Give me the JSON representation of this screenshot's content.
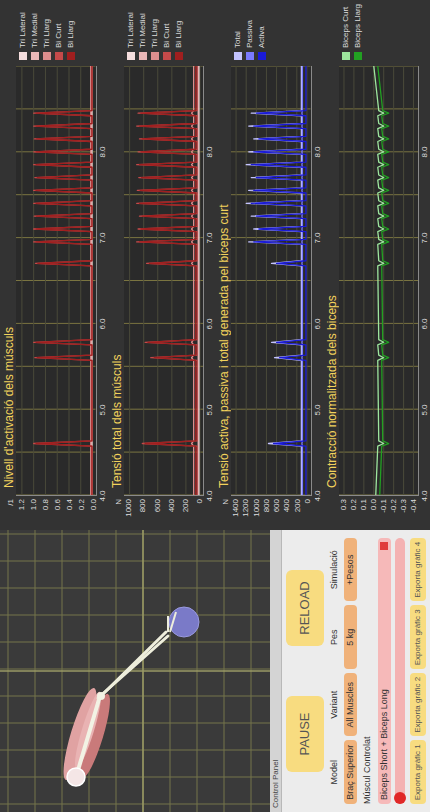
{
  "control_panel": {
    "title": "Control Panel",
    "buttons": [
      "PAUSE",
      "RELOAD"
    ],
    "fields": [
      {
        "label": "Model",
        "value": "Braç Superior"
      },
      {
        "label": "Variant",
        "value": "All Muscles"
      },
      {
        "label": "Pes",
        "value": "5 kg"
      },
      {
        "label": "Simulació",
        "value": "+Pesos"
      }
    ],
    "controlled_muscle": {
      "label": "Múscul Controlat",
      "value": "Biceps Short + Biceps Long"
    },
    "slider": {
      "level": 0.0
    },
    "export_buttons": [
      "Exporta gràfic 1",
      "Exporta gràfic 2",
      "Exporta gràfic 3",
      "Exporta gràfic 4"
    ]
  },
  "time_axis": {
    "ticks": [
      "4.0",
      "5.0",
      "6.0",
      "7.0",
      "8.0"
    ],
    "t": [
      4.0,
      4.57,
      4.6,
      4.63,
      5.57,
      5.6,
      5.63,
      5.75,
      5.78,
      5.81,
      6.67,
      6.7,
      6.73,
      6.92,
      6.95,
      6.98,
      7.07,
      7.1,
      7.13,
      7.22,
      7.25,
      7.28,
      7.37,
      7.4,
      7.43,
      7.52,
      7.55,
      7.58,
      7.67,
      7.7,
      7.73,
      7.82,
      7.85,
      7.88,
      7.97,
      8.0,
      8.03,
      8.12,
      8.15,
      8.18,
      8.27,
      8.3,
      8.33,
      8.42,
      8.45,
      8.48,
      9.0
    ]
  },
  "charts": [
    {
      "title": "Nivell d'activació dels músculs",
      "unit": "/1",
      "y_min": -0.05,
      "y_max": 1.3,
      "y_ticks": [
        "0.0",
        "0.2",
        "0.4",
        "0.6",
        "0.8",
        "1.0",
        "1.2"
      ],
      "series": [
        {
          "name": "Tri Lateral",
          "color": "#f5dede",
          "values": [
            0.01,
            0.01,
            0.01,
            0.01,
            0.01,
            0.01,
            0.01,
            0.01,
            0.01,
            0.01,
            0.01,
            0.01,
            0.01,
            0.01,
            0.01,
            0.01,
            0.01,
            0.01,
            0.01,
            0.01,
            0.01,
            0.01,
            0.01,
            0.01,
            0.01,
            0.01,
            0.01,
            0.01,
            0.01,
            0.01,
            0.01,
            0.01,
            0.01,
            0.01,
            0.01,
            0.01,
            0.01,
            0.01,
            0.01,
            0.01,
            0.01,
            0.01,
            0.01,
            0.01,
            0.01,
            0.01,
            0.01
          ]
        },
        {
          "name": "Tri Medial",
          "color": "#ebb8b8",
          "values": [
            0.02,
            0.02,
            0.02,
            0.02,
            0.02,
            0.02,
            0.02,
            0.02,
            0.02,
            0.02,
            0.02,
            0.02,
            0.02,
            0.02,
            0.02,
            0.02,
            0.02,
            0.02,
            0.02,
            0.02,
            0.02,
            0.02,
            0.02,
            0.02,
            0.02,
            0.02,
            0.02,
            0.02,
            0.02,
            0.02,
            0.02,
            0.02,
            0.02,
            0.02,
            0.02,
            0.02,
            0.02,
            0.02,
            0.02,
            0.02,
            0.02,
            0.02,
            0.02,
            0.02,
            0.02,
            0.02,
            0.02
          ]
        },
        {
          "name": "Tri Llarg",
          "color": "#dd8e8e",
          "values": [
            0.03,
            0.03,
            0.03,
            0.03,
            0.03,
            0.03,
            0.03,
            0.03,
            0.03,
            0.03,
            0.03,
            0.03,
            0.03,
            0.03,
            0.03,
            0.03,
            0.03,
            0.03,
            0.03,
            0.03,
            0.03,
            0.03,
            0.03,
            0.03,
            0.03,
            0.03,
            0.03,
            0.03,
            0.03,
            0.03,
            0.03,
            0.03,
            0.03,
            0.03,
            0.03,
            0.03,
            0.03,
            0.03,
            0.03,
            0.03,
            0.03,
            0.03,
            0.03,
            0.03,
            0.03,
            0.03,
            0.03
          ]
        },
        {
          "name": "Bi Curt",
          "color": "#c44a4a",
          "values": [
            0.01,
            0.01,
            1.0,
            0.01,
            0.01,
            0.98,
            0.01,
            0.01,
            1.0,
            0.01,
            0.01,
            0.97,
            0.01,
            0.01,
            1.0,
            0.01,
            0.01,
            1.0,
            0.01,
            0.01,
            0.99,
            0.01,
            0.01,
            1.0,
            0.01,
            0.01,
            1.0,
            0.01,
            0.01,
            0.98,
            0.01,
            0.01,
            1.0,
            0.01,
            0.01,
            1.0,
            0.01,
            0.01,
            0.99,
            0.01,
            0.01,
            1.0,
            0.01,
            0.01,
            1.0,
            0.01,
            0.01
          ]
        },
        {
          "name": "Bi Llarg",
          "color": "#a01f1f",
          "values": [
            0.01,
            0.01,
            0.96,
            0.01,
            0.01,
            0.94,
            0.01,
            0.01,
            0.96,
            0.01,
            0.01,
            0.93,
            0.01,
            0.01,
            0.96,
            0.01,
            0.01,
            0.96,
            0.01,
            0.01,
            0.95,
            0.01,
            0.01,
            0.96,
            0.01,
            0.01,
            0.96,
            0.01,
            0.01,
            0.94,
            0.01,
            0.01,
            0.96,
            0.01,
            0.01,
            0.96,
            0.01,
            0.01,
            0.95,
            0.01,
            0.01,
            0.96,
            0.01,
            0.01,
            0.96,
            0.01,
            0.01
          ]
        }
      ]
    },
    {
      "title": "Tensió total dels músculs",
      "unit": "N",
      "y_min": -50,
      "y_max": 1080,
      "y_ticks": [
        "0",
        "200",
        "400",
        "600",
        "800",
        "1000"
      ],
      "series": [
        {
          "name": "Tri Lateral",
          "color": "#f5dede",
          "values": [
            15,
            15,
            15,
            15,
            15,
            15,
            15,
            15,
            15,
            15,
            15,
            15,
            15,
            15,
            15,
            15,
            15,
            15,
            15,
            15,
            15,
            15,
            15,
            15,
            15,
            15,
            15,
            15,
            15,
            15,
            15,
            15,
            15,
            15,
            15,
            15,
            15,
            15,
            15,
            15,
            15,
            15,
            15,
            15,
            15,
            15,
            15
          ]
        },
        {
          "name": "Tri Medial",
          "color": "#ebb8b8",
          "values": [
            25,
            25,
            25,
            25,
            25,
            25,
            25,
            25,
            25,
            25,
            25,
            25,
            25,
            25,
            25,
            25,
            25,
            25,
            25,
            25,
            25,
            25,
            25,
            25,
            25,
            25,
            25,
            25,
            25,
            25,
            25,
            25,
            25,
            25,
            25,
            25,
            25,
            25,
            25,
            25,
            25,
            25,
            25,
            25,
            25,
            25,
            25
          ]
        },
        {
          "name": "Tri Llarg",
          "color": "#dd8e8e",
          "values": [
            90,
            90,
            120,
            90,
            90,
            120,
            90,
            90,
            120,
            90,
            90,
            120,
            90,
            90,
            120,
            90,
            90,
            120,
            90,
            90,
            120,
            90,
            90,
            120,
            90,
            90,
            120,
            90,
            90,
            120,
            90,
            90,
            120,
            90,
            90,
            120,
            90,
            90,
            120,
            90,
            90,
            120,
            90,
            90,
            120,
            90,
            90
          ]
        },
        {
          "name": "Bi Curt",
          "color": "#c44a4a",
          "values": [
            40,
            40,
            820,
            40,
            40,
            700,
            40,
            40,
            780,
            40,
            40,
            760,
            40,
            40,
            900,
            40,
            40,
            880,
            40,
            40,
            860,
            40,
            40,
            900,
            40,
            40,
            890,
            40,
            40,
            870,
            40,
            40,
            900,
            40,
            40,
            880,
            40,
            40,
            860,
            40,
            40,
            900,
            40,
            40,
            880,
            40,
            40
          ]
        },
        {
          "name": "Bi Llarg",
          "color": "#a01f1f",
          "values": [
            60,
            60,
            780,
            60,
            60,
            650,
            60,
            60,
            740,
            60,
            60,
            720,
            60,
            60,
            860,
            60,
            60,
            840,
            60,
            60,
            820,
            60,
            60,
            860,
            60,
            60,
            850,
            60,
            60,
            830,
            60,
            60,
            860,
            60,
            60,
            840,
            60,
            60,
            820,
            60,
            60,
            860,
            60,
            60,
            840,
            60,
            60
          ]
        }
      ]
    },
    {
      "title": "Tensió activa, passiva i total generada pel biceps curt",
      "unit": "N",
      "y_min": -70,
      "y_max": 1500,
      "y_ticks": [
        "0",
        "200",
        "400",
        "600",
        "800",
        "1000",
        "1200",
        "1400"
      ],
      "series": [
        {
          "name": "Total",
          "color": "#c4c4ff",
          "values": [
            110,
            110,
            760,
            110,
            110,
            640,
            110,
            110,
            700,
            110,
            110,
            700,
            110,
            110,
            1150,
            110,
            110,
            1050,
            110,
            110,
            1100,
            110,
            110,
            1200,
            110,
            110,
            1150,
            110,
            110,
            1100,
            110,
            110,
            1200,
            110,
            110,
            1150,
            110,
            110,
            1050,
            110,
            110,
            1150,
            110,
            110,
            1100,
            110,
            110
          ]
        },
        {
          "name": "Passiva",
          "color": "#7a7aff",
          "values": [
            90,
            90,
            100,
            90,
            90,
            100,
            90,
            90,
            100,
            90,
            90,
            100,
            90,
            90,
            100,
            90,
            90,
            100,
            90,
            90,
            100,
            90,
            90,
            100,
            90,
            90,
            100,
            90,
            90,
            100,
            90,
            90,
            100,
            90,
            90,
            100,
            90,
            90,
            100,
            90,
            90,
            100,
            90,
            90,
            100,
            90,
            90
          ]
        },
        {
          "name": "Activa",
          "color": "#1a1ad8",
          "values": [
            20,
            20,
            660,
            20,
            20,
            540,
            20,
            20,
            600,
            20,
            20,
            600,
            20,
            20,
            1050,
            20,
            20,
            950,
            20,
            20,
            1000,
            20,
            20,
            1100,
            20,
            20,
            1050,
            20,
            20,
            1000,
            20,
            20,
            1100,
            20,
            20,
            1050,
            20,
            20,
            950,
            20,
            20,
            1050,
            20,
            20,
            1000,
            20,
            20
          ]
        }
      ]
    },
    {
      "title": "Contracció normalitzada dels biceps",
      "y_min": -0.45,
      "y_max": 0.35,
      "y_ticks": [
        "-0.4",
        "-0.3",
        "-0.2",
        "-0.1",
        "0.0",
        "0.1",
        "0.2",
        "0.3"
      ],
      "series": [
        {
          "name": "Biceps Curt",
          "color": "#9ee69e",
          "values": [
            -0.02,
            -0.04,
            -0.1,
            -0.05,
            -0.04,
            -0.1,
            -0.05,
            -0.04,
            -0.1,
            -0.05,
            -0.04,
            -0.1,
            -0.05,
            -0.04,
            -0.1,
            -0.05,
            -0.04,
            -0.1,
            -0.05,
            -0.04,
            -0.1,
            -0.05,
            -0.04,
            -0.1,
            -0.05,
            -0.04,
            -0.1,
            -0.05,
            -0.04,
            -0.1,
            -0.05,
            -0.04,
            -0.1,
            -0.05,
            -0.04,
            -0.1,
            -0.05,
            -0.04,
            -0.1,
            -0.05,
            -0.04,
            -0.1,
            -0.05,
            -0.04,
            -0.1,
            -0.05,
            0.0
          ]
        },
        {
          "name": "Biceps Llarg",
          "color": "#22a022",
          "values": [
            -0.06,
            -0.08,
            -0.15,
            -0.09,
            -0.08,
            -0.15,
            -0.09,
            -0.08,
            -0.15,
            -0.09,
            -0.08,
            -0.15,
            -0.09,
            -0.08,
            -0.15,
            -0.09,
            -0.08,
            -0.15,
            -0.09,
            -0.08,
            -0.15,
            -0.09,
            -0.08,
            -0.15,
            -0.09,
            -0.08,
            -0.15,
            -0.09,
            -0.08,
            -0.15,
            -0.09,
            -0.08,
            -0.15,
            -0.09,
            -0.08,
            -0.15,
            -0.09,
            -0.08,
            -0.15,
            -0.09,
            -0.08,
            -0.15,
            -0.09,
            -0.08,
            -0.15,
            -0.09,
            -0.04
          ]
        }
      ]
    }
  ]
}
